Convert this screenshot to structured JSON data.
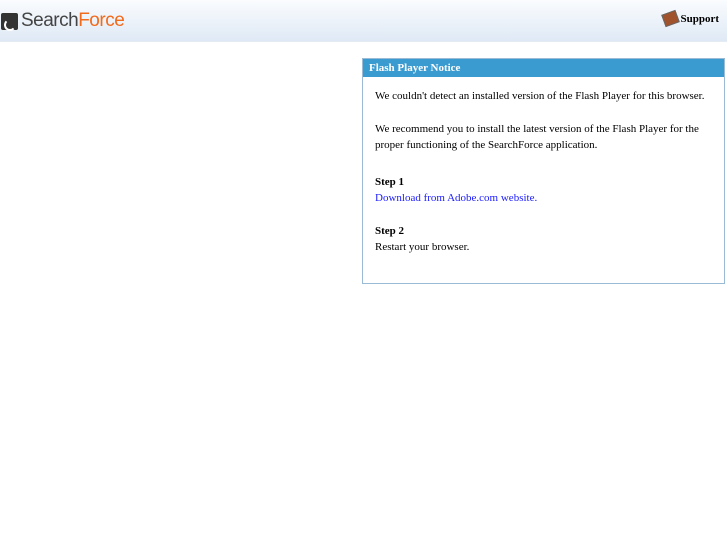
{
  "header": {
    "logo_part1": "Search",
    "logo_part2": "Force",
    "support_label": "Support"
  },
  "notice": {
    "title": "Flash Player Notice",
    "line1": "We couldn't detect an installed version of the Flash Player for this browser.",
    "line2": "We recommend you to install the latest version of the Flash Player for the proper functioning of the",
    "line3": "SearchForce application.",
    "step1_label": "Step 1",
    "step1_link": "Download from Adobe.com website.",
    "step2_label": "Step 2",
    "step2_text": "Restart your browser."
  }
}
